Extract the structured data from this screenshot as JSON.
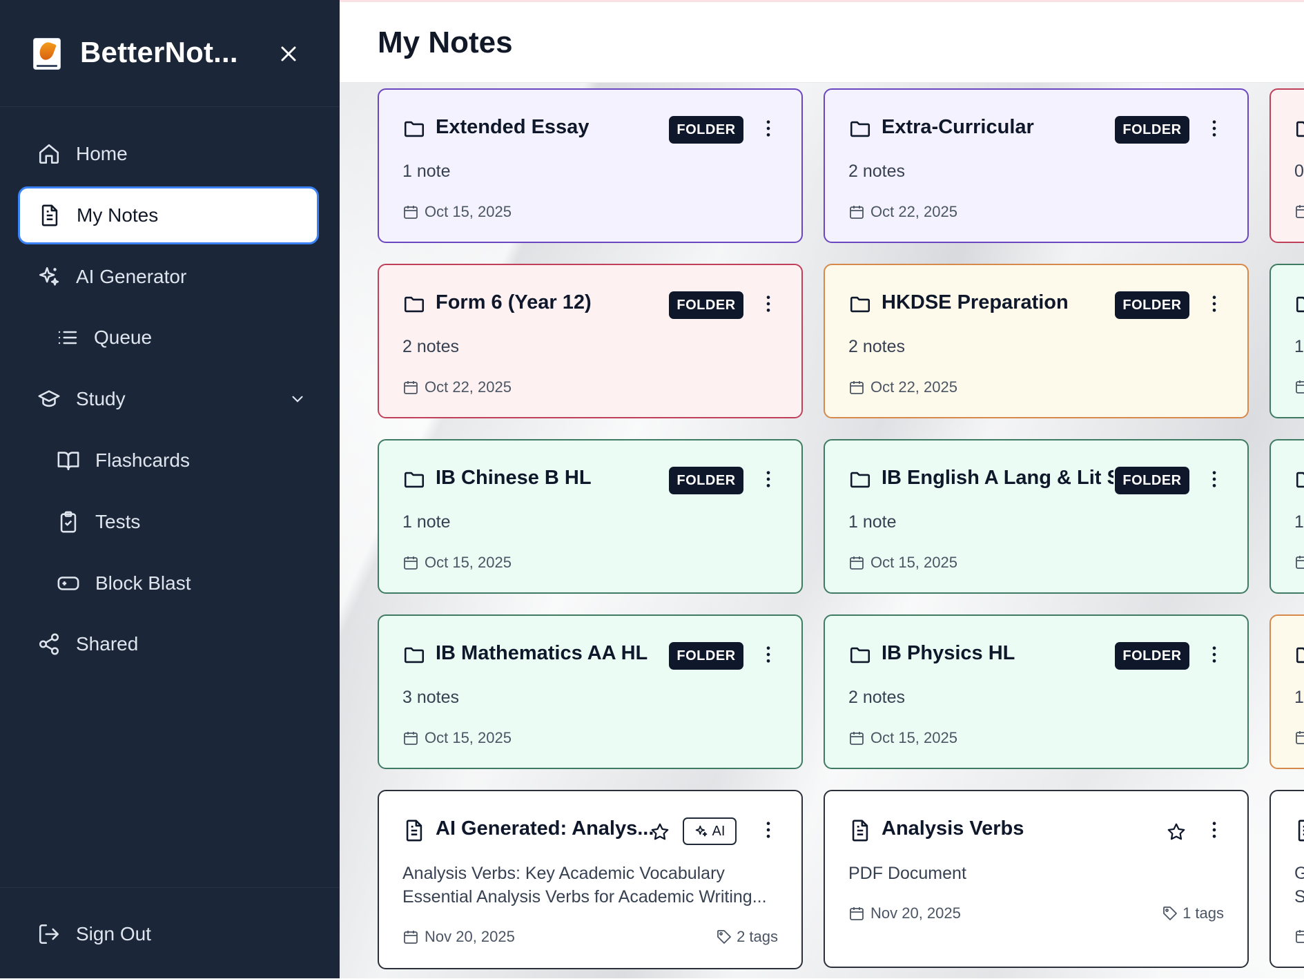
{
  "app": {
    "name": "BetterNot...",
    "accent_color": "#3b82f6",
    "sidebar_color": "#1b2638"
  },
  "sidebar": {
    "items": [
      {
        "label": "Home",
        "icon": "home-icon"
      },
      {
        "label": "My Notes",
        "icon": "document-icon",
        "active": true
      },
      {
        "label": "AI Generator",
        "icon": "sparkles-icon"
      },
      {
        "label": "Queue",
        "icon": "list-icon"
      },
      {
        "label": "Study",
        "icon": "graduation-cap-icon"
      },
      {
        "label": "Flashcards",
        "icon": "book-open-icon"
      },
      {
        "label": "Tests",
        "icon": "clipboard-check-icon"
      },
      {
        "label": "Block Blast",
        "icon": "gamepad-icon"
      },
      {
        "label": "Shared",
        "icon": "share-icon"
      }
    ],
    "sign_out": "Sign Out"
  },
  "main": {
    "title": "My Notes",
    "folder_badge": "FOLDER",
    "ai_badge": "AI",
    "cards": [
      {
        "title": "Extended Essay",
        "count": "1 note",
        "date": "Oct 15, 2025",
        "color": "#f4f2fe"
      },
      {
        "title": "Extra-Curricular",
        "count": "2 notes",
        "date": "Oct 22, 2025",
        "color": "#f4f2fe"
      },
      {
        "title": "Form 6 (Year 12)",
        "count": "2 notes",
        "date": "Oct 22, 2025",
        "color": "#fef1f2"
      },
      {
        "title": "HKDSE Preparation",
        "count": "2 notes",
        "date": "Oct 22, 2025",
        "color": "#fefaeb"
      },
      {
        "title": "IB Chinese B HL",
        "count": "1 note",
        "date": "Oct 15, 2025",
        "color": "#eafcf4"
      },
      {
        "title": "IB English A Lang & Lit SL",
        "count": "1 note",
        "date": "Oct 15, 2025",
        "color": "#eafcf4"
      },
      {
        "title": "IB Mathematics AA HL",
        "count": "3 notes",
        "date": "Oct 15, 2025",
        "color": "#eafcf4"
      },
      {
        "title": "IB Physics HL",
        "count": "2 notes",
        "date": "Oct 15, 2025",
        "color": "#eafcf4"
      }
    ],
    "note_cards": [
      {
        "title": "AI Generated: Analys...",
        "desc_line1": "Analysis Verbs: Key Academic Vocabulary",
        "desc_line2": "Essential Analysis Verbs for Academic Writing...",
        "date": "Nov 20, 2025",
        "tags": "2 tags"
      },
      {
        "title": "Analysis Verbs",
        "desc_line1": "PDF Document",
        "date": "Nov 20, 2025",
        "tags": "1 tags"
      }
    ],
    "partial_column": {
      "counts": [
        "0",
        "1",
        "1",
        "1"
      ],
      "note_desc": [
        "G",
        "S"
      ]
    }
  }
}
